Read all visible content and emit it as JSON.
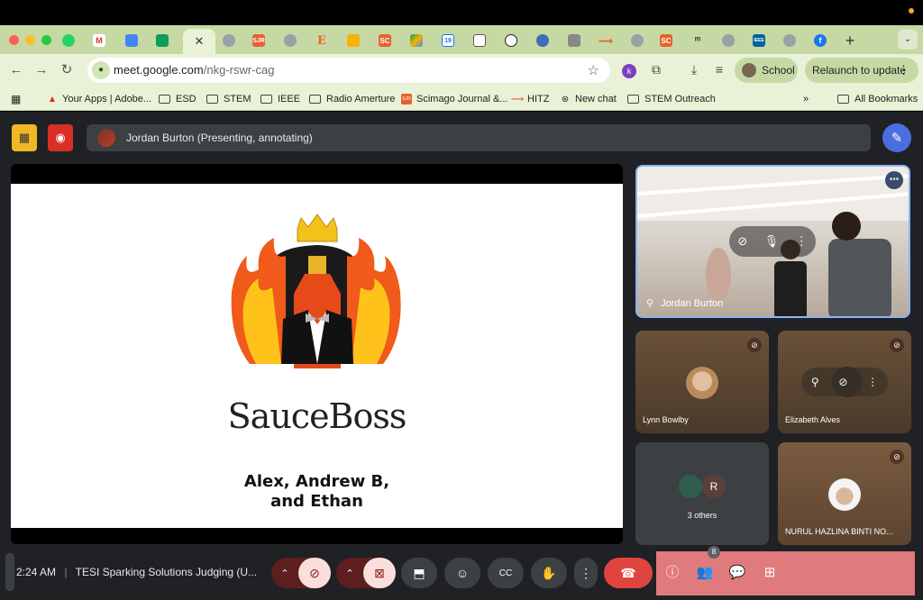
{
  "browser": {
    "url_host": "meet.google.com",
    "url_path": "/nkg-rswr-cag",
    "profile_label": "School",
    "relaunch_label": "Relaunch to update",
    "tabs": [
      "",
      "M",
      "",
      "",
      "",
      "",
      "SJR",
      "",
      "E",
      "",
      "SC",
      "",
      "19",
      "",
      "",
      "",
      "",
      "",
      "",
      "SC",
      "",
      "",
      "IEEE",
      "",
      "f"
    ],
    "bookmarks": [
      {
        "label": "Your Apps | Adobe..."
      },
      {
        "label": "ESD"
      },
      {
        "label": "STEM"
      },
      {
        "label": "IEEE"
      },
      {
        "label": "Radio Amerture"
      },
      {
        "label": "Scimago Journal &..."
      },
      {
        "label": "HITZ"
      },
      {
        "label": "New chat"
      },
      {
        "label": "STEM Outreach"
      }
    ],
    "all_bookmarks_label": "All Bookmarks"
  },
  "meet": {
    "presenter_text": "Jordan Burton (Presenting, annotating)",
    "slide": {
      "title": "SauceBoss",
      "line1": "Alex, Andrew B,",
      "line2": "and Ethan"
    },
    "participants": {
      "featured": "Jordan Burton",
      "tile1": "Lynn Bowlby",
      "tile2": "Elizabeth Alves",
      "tile3": "3 others",
      "tile3_avatar_letter": "R",
      "tile4": "NURUL HAZLINA BINTI NO..."
    },
    "time": "2:24 AM",
    "meeting_title": "TESI Sparking Solutions Judging (U...",
    "people_count": "8"
  },
  "colors": {
    "tab_strip": "#c6d9a4",
    "toolbar": "#e9f2d6",
    "meet_bg": "#202124",
    "end_call": "#e0443e",
    "active_blue": "#8ab4f8"
  }
}
